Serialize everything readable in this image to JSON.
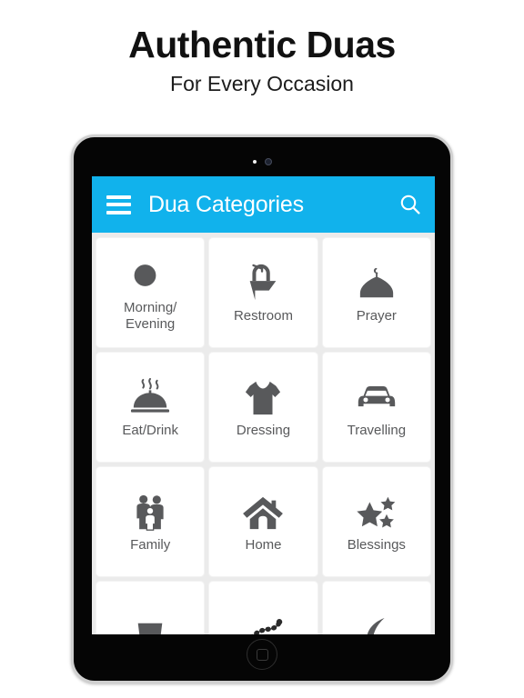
{
  "promo": {
    "title": "Authentic Duas",
    "subtitle": "For Every Occasion"
  },
  "colors": {
    "appbar_blue": "#11b2ec",
    "icon_gray": "#58595b",
    "screen_background": "#ebebeb",
    "tile_white": "#ffffff",
    "page_background": "#ffffff",
    "bezel_black": "#050505"
  },
  "device": {
    "name": "tablet",
    "camera_icon": "camera-lens-icon",
    "led_icon": "indicator-led-icon",
    "home_button": "home-button"
  },
  "app": {
    "appbar": {
      "menu_icon": "hamburger-menu-icon",
      "title": "Dua Categories",
      "search_icon": "search-icon"
    },
    "grid": {
      "tiles": [
        {
          "label": "Morning/\nEvening",
          "icon": "sun-moon-icon"
        },
        {
          "label": "Restroom",
          "icon": "sink-faucet-icon"
        },
        {
          "label": "Prayer",
          "icon": "mosque-dome-icon"
        },
        {
          "label": "Eat/Drink",
          "icon": "food-cloche-icon"
        },
        {
          "label": "Dressing",
          "icon": "tshirt-icon"
        },
        {
          "label": "Travelling",
          "icon": "car-icon"
        },
        {
          "label": "Family",
          "icon": "family-icon"
        },
        {
          "label": "Home",
          "icon": "house-icon"
        },
        {
          "label": "Blessings",
          "icon": "stars-icon"
        },
        {
          "label": "",
          "icon": "cup-icon"
        },
        {
          "label": "",
          "icon": "prayer-beads-icon"
        },
        {
          "label": "",
          "icon": "crescent-moon-icon"
        }
      ]
    }
  }
}
